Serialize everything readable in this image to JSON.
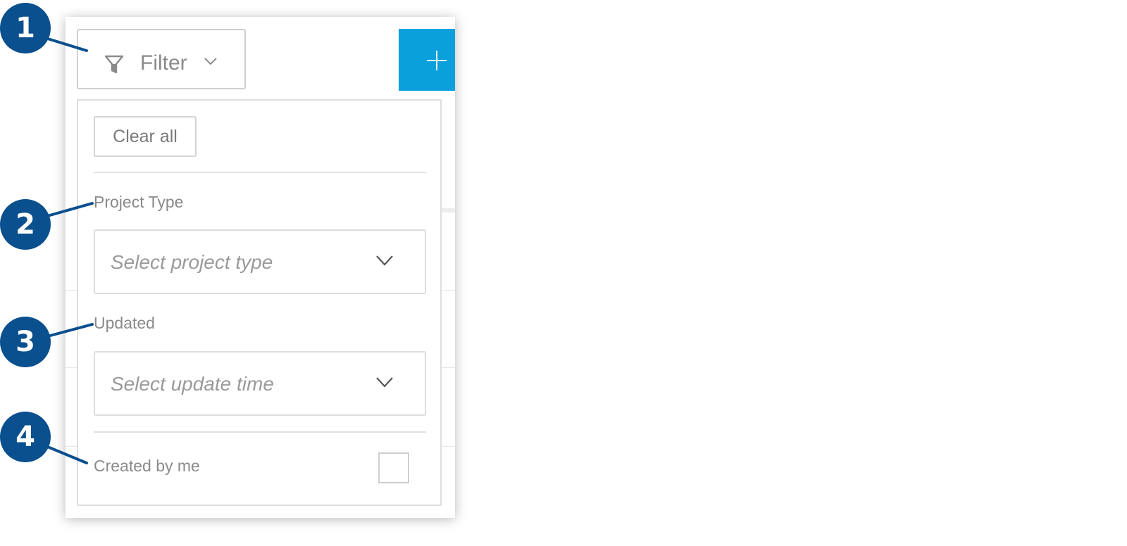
{
  "toolbar": {
    "filter_label": "Filter",
    "filter_icon": "funnel-icon",
    "filter_chevron_icon": "chevron-down-icon",
    "add_icon": "plus-icon"
  },
  "filter_panel": {
    "clear_all_label": "Clear all",
    "project_type": {
      "label": "Project Type",
      "placeholder": "Select project type",
      "chevron_icon": "chevron-down-icon"
    },
    "updated": {
      "label": "Updated",
      "placeholder": "Select update time",
      "chevron_icon": "chevron-down-icon"
    },
    "created_by_me": {
      "label": "Created by me",
      "checked": false
    }
  },
  "callouts": [
    "1",
    "2",
    "3",
    "4"
  ],
  "colors": {
    "accent": "#0aa0dc",
    "callout": "#0a4f8e",
    "text_muted": "#8a8a8a"
  }
}
